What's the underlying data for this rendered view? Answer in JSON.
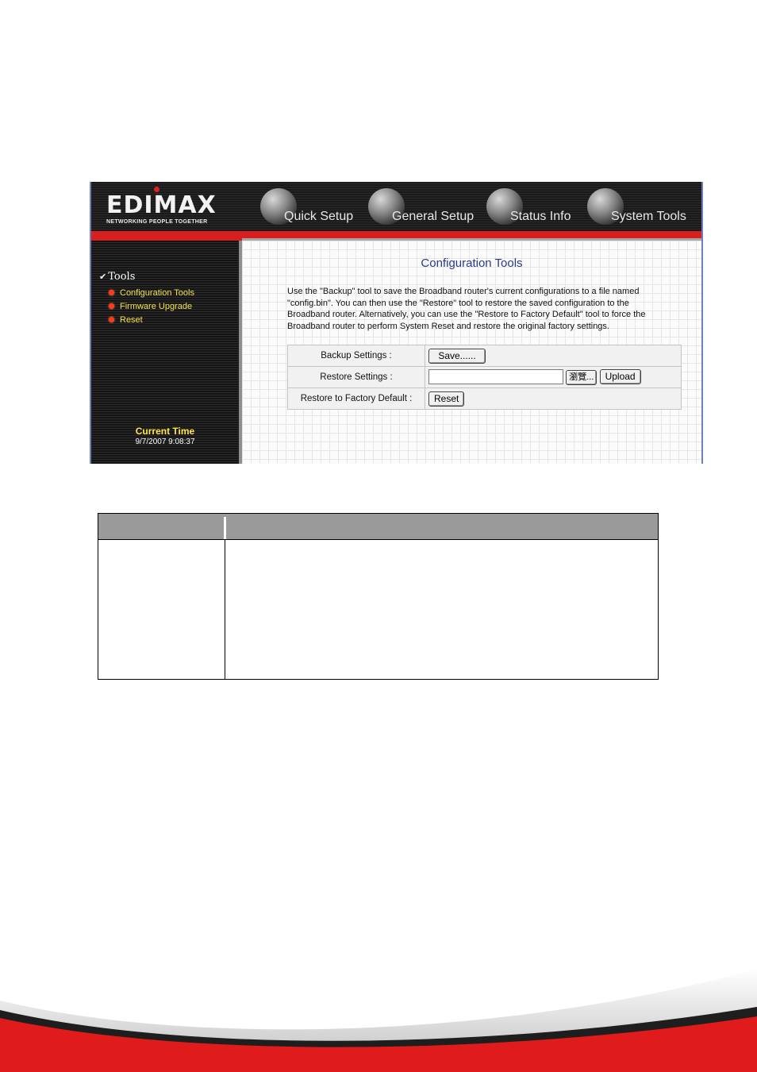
{
  "brand": {
    "name": "EDIMAX",
    "tagline": "NETWORKING PEOPLE TOGETHER"
  },
  "nav": {
    "quick_setup": "Quick Setup",
    "general_setup": "General Setup",
    "status_info": "Status Info",
    "system_tools": "System Tools"
  },
  "sidebar": {
    "section": "Tools",
    "items": [
      {
        "label": "Configuration Tools"
      },
      {
        "label": "Firmware Upgrade"
      },
      {
        "label": "Reset"
      }
    ],
    "current_time_label": "Current Time",
    "current_time_value": "9/7/2007 9:08:37"
  },
  "content": {
    "title": "Configuration Tools",
    "description": "Use the \"Backup\" tool to save the Broadband router's current configurations to a file named \"config.bin\". You can then use the \"Restore\" tool to restore the saved configuration to the Broadband router. Alternatively, you can use the \"Restore to Factory Default\" tool to force the Broadband router to perform System Reset and restore the original factory settings.",
    "rows": {
      "backup_label": "Backup Settings :",
      "save_button": "Save......",
      "restore_label": "Restore Settings :",
      "restore_file_value": "",
      "browse_button": "瀏覽...",
      "upload_button": "Upload",
      "factory_label": "Restore to Factory Default :",
      "reset_button": "Reset"
    }
  },
  "colors": {
    "accent_red": "#d81f1f",
    "title_blue": "#283b8a",
    "menu_yellow": "#f5e24a"
  }
}
